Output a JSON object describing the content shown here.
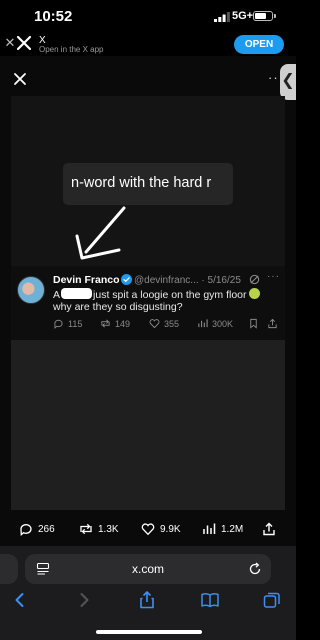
{
  "status_bar": {
    "time": "10:52",
    "network": "5G+",
    "battery_level": 0.7
  },
  "app_banner": {
    "title": "X",
    "subtitle": "Open in the X app",
    "open_label": "OPEN"
  },
  "media": {
    "caption": "n-word with the hard r",
    "tweet": {
      "author_name": "Devin Franco",
      "handle_date": "@devinfranc... · 5/16/25",
      "text_a": "A",
      "text_b": "just spit a loogie on the gym floor",
      "text_line2": "why are they so disgusting?",
      "replies": "115",
      "reposts": "149",
      "likes": "355",
      "views": "300K"
    }
  },
  "engagement": {
    "replies": "266",
    "reposts": "1.3K",
    "likes": "9.9K",
    "views": "1.2M"
  },
  "browser": {
    "url": "x.com"
  },
  "colors": {
    "accent": "#1d9bf0",
    "background": "#000000",
    "toolbar": "#1c1c1e"
  }
}
